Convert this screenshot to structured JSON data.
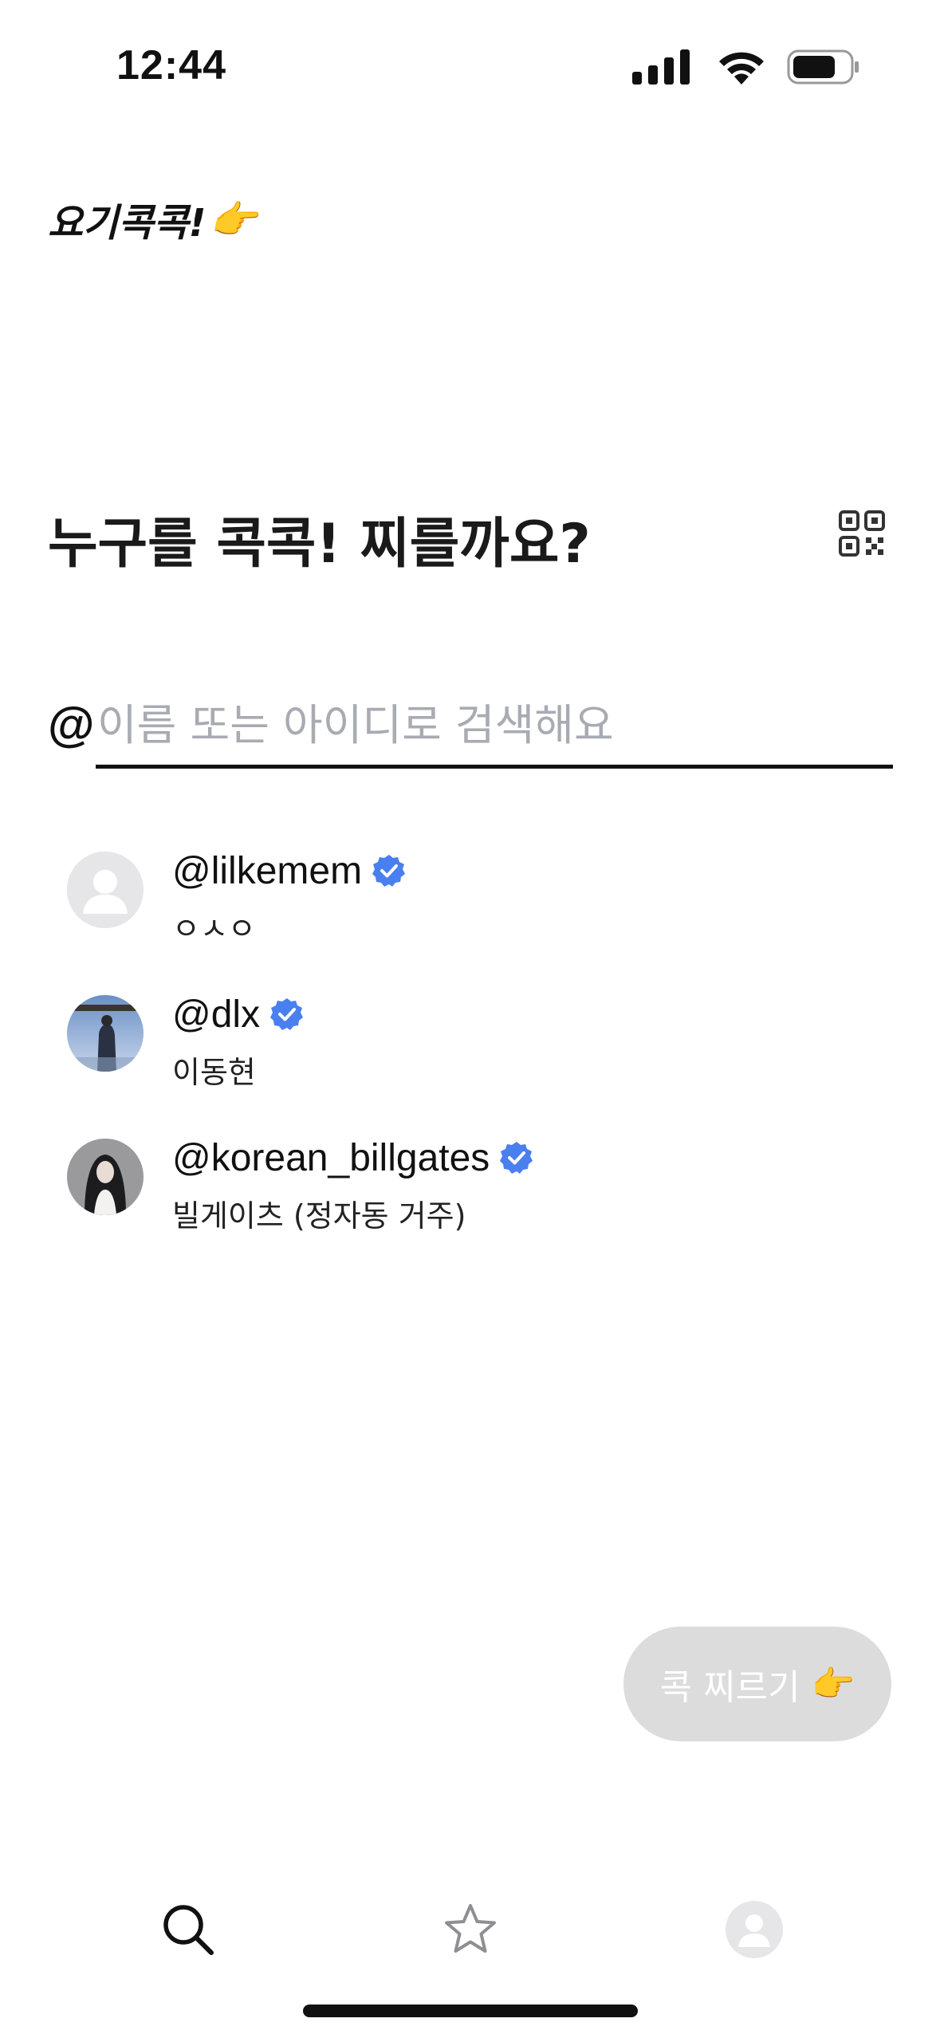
{
  "status_bar": {
    "time": "12:44",
    "icons": [
      "cellular-signal-icon",
      "wifi-icon",
      "battery-icon"
    ]
  },
  "app": {
    "logo_text": "요기콕콕!",
    "logo_emoji": "👉"
  },
  "main": {
    "heading": "누구를 콕콕! 찌를까요?",
    "qr_icon": "qr-code-icon"
  },
  "search": {
    "prefix": "@",
    "value": "",
    "placeholder": "이름 또는 아이디로 검색해요"
  },
  "users": [
    {
      "handle": "@lilkemem",
      "name": "ㅇㅅㅇ",
      "verified": true,
      "avatar": "default-avatar"
    },
    {
      "handle": "@dlx",
      "name": "이동현",
      "verified": true,
      "avatar": "photo-avatar"
    },
    {
      "handle": "@korean_billgates",
      "name": "빌게이츠 (정자동 거주)",
      "verified": true,
      "avatar": "photo-avatar"
    }
  ],
  "poke_button": {
    "label": "콕 찌르기",
    "emoji": "👉"
  },
  "bottom_nav": {
    "items": [
      "search-icon",
      "star-icon",
      "profile-icon"
    ]
  },
  "colors": {
    "verified": "#4a7ff0",
    "placeholder": "#a8abb2",
    "poke_button_bg": "#dcdcdd",
    "text": "#111111"
  }
}
